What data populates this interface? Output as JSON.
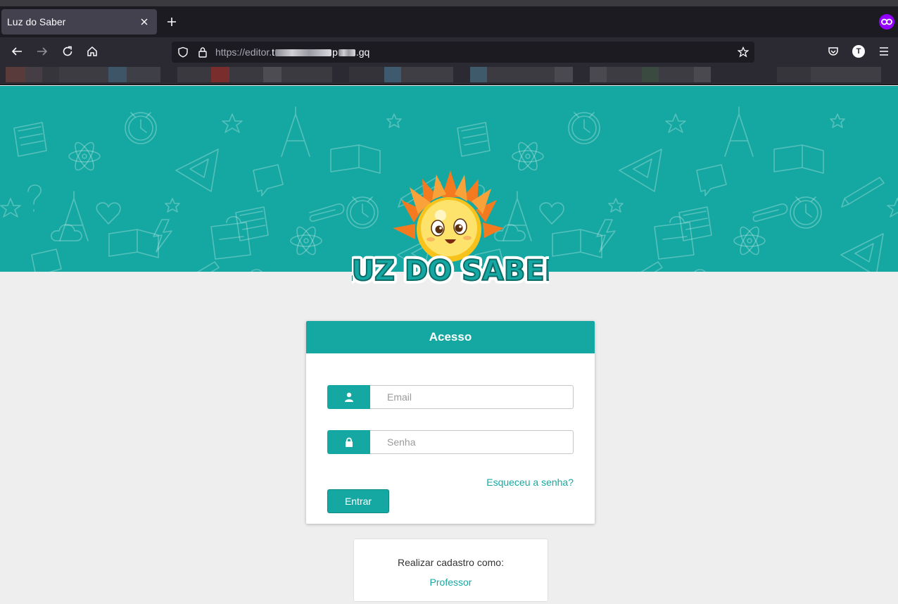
{
  "browser": {
    "tab_title": "Luz do Saber",
    "url_prefix": "https://editor.",
    "url_suffix": ".gq",
    "url_partial": "t",
    "url_partial2": "p"
  },
  "banner": {
    "logo_text": "LUZ DO SABER"
  },
  "login": {
    "title": "Acesso",
    "email_placeholder": "Email",
    "password_placeholder": "Senha",
    "forgot_label": "Esqueceu a senha?",
    "submit_label": "Entrar"
  },
  "register": {
    "prompt": "Realizar cadastro como:",
    "professor_label": "Professor"
  },
  "colors": {
    "accent": "#15a8a2",
    "page_bg": "#eeeeee",
    "chrome_bg": "#2b2a33"
  }
}
